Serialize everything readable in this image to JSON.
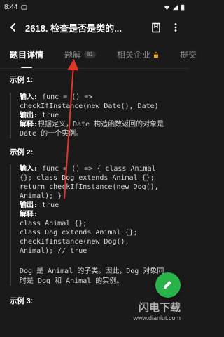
{
  "status_bar": {
    "time": "8:44"
  },
  "header": {
    "title": "2618. 检查是否是类的..."
  },
  "tabs": [
    {
      "label": "题目详情"
    },
    {
      "label": "题解",
      "badge": "81"
    },
    {
      "label": "相关企业"
    },
    {
      "label": "提交"
    }
  ],
  "examples": [
    {
      "title": "示例 1:",
      "input_label": "输入:",
      "input_lines": [
        " func = () =>",
        "checkIfInstance(new Date(), Date)"
      ],
      "output_label": "输出:",
      "output_value": " true",
      "explain_label": "解释:",
      "explain_lines": [
        "根据定义，Date 构造函数返回的对象是",
        "Date 的一个实例。"
      ]
    },
    {
      "title": "示例 2:",
      "input_label": "输入:",
      "input_lines": [
        " func = () => { class Animal",
        "{}; class Dog extends Animal {};",
        "return checkIfInstance(new Dog(),",
        "Animal); }"
      ],
      "output_label": "输出:",
      "output_value": " true",
      "explain_label": "解释:",
      "explain_lines": [
        "class Animal {};",
        "class Dog extends Animal {};",
        "checkIfInstance(new Dog(),",
        "Animal); // true"
      ],
      "note_lines": [
        "Dog 是 Animal 的子类。因此，Dog 对象同",
        "时是 Dog 和 Animal 的实例。"
      ]
    },
    {
      "title": "示例 3:"
    }
  ],
  "watermark": {
    "line1": "闪电下载",
    "line2": "www.dianlut.com"
  },
  "colors": {
    "background": "#1a1a1a",
    "fab": "#27b24a",
    "annotation_arrow": "#e0352b"
  }
}
